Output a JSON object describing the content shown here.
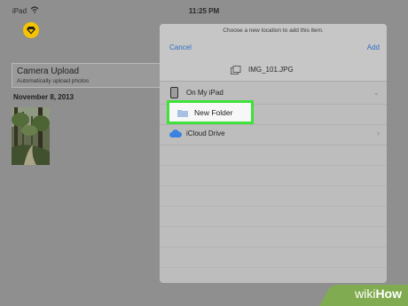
{
  "status": {
    "device": "iPad",
    "time": "11:25 PM"
  },
  "app": {
    "upload_title": "Camera Upload",
    "upload_subtitle": "Automatically upload photos",
    "date_label": "November 8, 2013"
  },
  "dialog": {
    "prompt": "Choose a new location to add this item.",
    "cancel_label": "Cancel",
    "add_label": "Add",
    "file_name": "IMG_101.JPG",
    "locations": [
      {
        "label": "On My iPad",
        "icon": "ipad-icon"
      },
      {
        "label": "New Folder",
        "icon": "folder-icon"
      },
      {
        "label": "iCloud Drive",
        "icon": "cloud-icon"
      }
    ]
  },
  "colors": {
    "highlight": "#3fe23b",
    "link": "#2f6fc4",
    "logo": "#f5c300"
  },
  "watermark": {
    "part1": "wiki",
    "part2": "How"
  }
}
